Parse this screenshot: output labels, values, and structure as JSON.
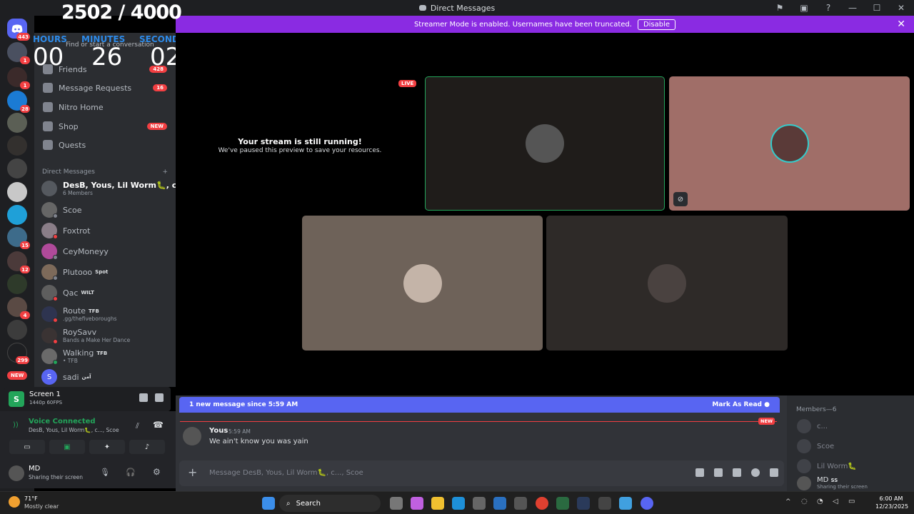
{
  "window": {
    "title": "Direct Messages"
  },
  "banner": {
    "text": "Streamer Mode is enabled. Usernames have been truncated.",
    "disable_label": "Disable"
  },
  "timer": {
    "count": "2502 / 4000",
    "hours_label": "HOURS",
    "minutes_label": "MINUTES",
    "seconds_label": "SECONDS",
    "hours": "00",
    "minutes": "26",
    "seconds": "02"
  },
  "rail": {
    "home_badge": "443",
    "badges": [
      "1",
      "1",
      "28",
      "15",
      "12",
      "4",
      "299"
    ],
    "new_label": "NEW"
  },
  "sidebar": {
    "find_placeholder": "Find or start a conversation",
    "friends": {
      "label": "Friends",
      "badge": "428"
    },
    "message_requests": {
      "label": "Message Requests",
      "badge": "16"
    },
    "nitro": {
      "label": "Nitro Home"
    },
    "shop": {
      "label": "Shop",
      "badge": "NEW"
    },
    "quests": {
      "label": "Quests"
    },
    "dm_header": "Direct Messages",
    "dms": [
      {
        "name": "DesB, Yous, Lil Worm🐛, c...",
        "sub": "6 Members"
      },
      {
        "name": "Scoe",
        "sub": ""
      },
      {
        "name": "Foxtrot",
        "sub": ""
      },
      {
        "name": "CeyMoneyy",
        "sub": ""
      },
      {
        "name": "Plutooo",
        "tag": "Spot",
        "sub": ""
      },
      {
        "name": "Qac",
        "tag": "WILT",
        "sub": ""
      },
      {
        "name": "Route",
        "tag": "TFB",
        "sub": ".gg/thefiveboroughs"
      },
      {
        "name": "RoySavv",
        "sub": "Bands a Make Her Dance"
      },
      {
        "name": "Walking",
        "tag": "TFB",
        "sub": "• TFB"
      },
      {
        "name": "sadi",
        "tag": "آمن",
        "sub": ""
      }
    ]
  },
  "share": {
    "title": "Screen 1",
    "quality": "1440p 60FPS"
  },
  "voice": {
    "status": "Voice Connected",
    "channel": "DesB, Yous, Lil Worm🐛, c..., Scoe"
  },
  "user": {
    "name": "MD",
    "status": "Sharing their screen"
  },
  "stage": {
    "paused_title": "Your stream is still running!",
    "paused_sub": "We've paused this preview to save your resources.",
    "live_label": "LIVE"
  },
  "chat": {
    "new_bar_text": "1 new message since 5:59 AM",
    "mark_read": "Mark As Read",
    "new_divider": "NEW",
    "message": {
      "author": "Yous",
      "time": "5:59 AM",
      "text": "We ain't know you was yain"
    },
    "composer_placeholder": "Message DesB, Yous, Lil Worm🐛, c..., Scoe"
  },
  "members": {
    "header": "Members—6",
    "list": [
      {
        "name": "c..."
      },
      {
        "name": "Scoe"
      },
      {
        "name": "Lil Worm🐛"
      },
      {
        "name": "MD",
        "tag": "SS",
        "sub": "Sharing their screen"
      }
    ]
  },
  "taskbar": {
    "weather_temp": "71°F",
    "weather_desc": "Mostly clear",
    "search_label": "Search",
    "time": "6:00 AM",
    "date": "12/23/2025"
  },
  "colors": {
    "blurple": "#5865f2",
    "banner": "#8a2be2",
    "red": "#f23f42",
    "green": "#23a55a"
  }
}
